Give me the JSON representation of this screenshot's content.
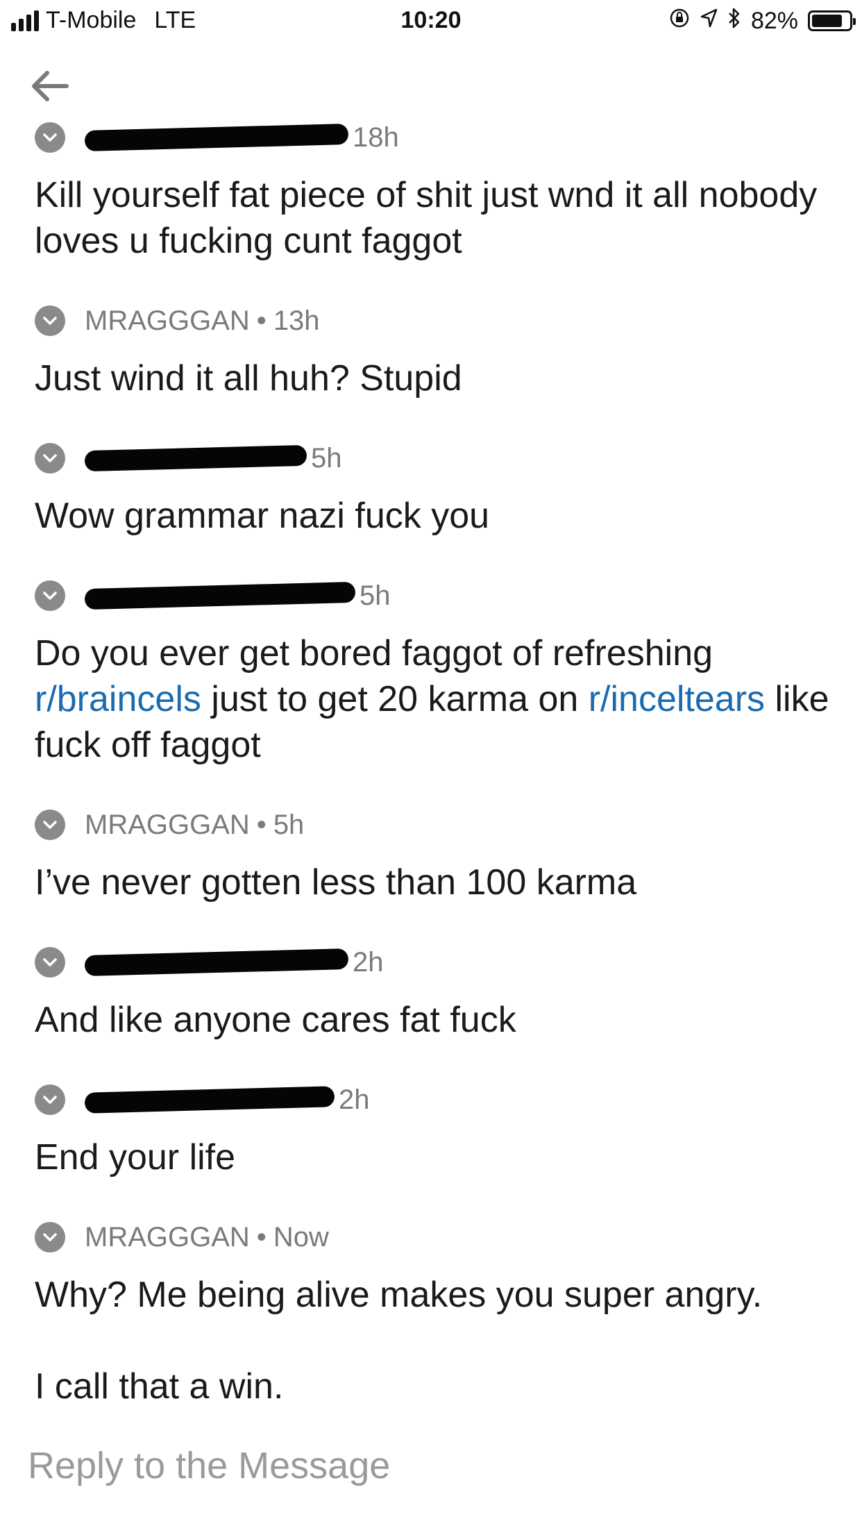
{
  "status_bar": {
    "carrier": "T-Mobile",
    "network": "LTE",
    "time": "10:20",
    "battery": "82%",
    "battery_level": 0.82
  },
  "messages": [
    {
      "author": "",
      "time": "18h",
      "redacted": true,
      "text": "Kill yourself fat piece of shit just wnd it all nobody loves u fucking cunt faggot"
    },
    {
      "author": "MRAGGGAN",
      "time": "13h",
      "redacted": false,
      "text": "Just wind it all huh? Stupid"
    },
    {
      "author": "",
      "time": "5h",
      "redacted": true,
      "text": "Wow grammar nazi fuck you"
    },
    {
      "author": "",
      "time": "5h",
      "redacted": true,
      "text_parts": [
        {
          "t": "Do you ever get bored faggot of refreshing "
        },
        {
          "t": "r/braincels",
          "link": true
        },
        {
          "t": " just to get 20 karma on "
        },
        {
          "t": "r/inceltears",
          "link": true
        },
        {
          "t": " like fuck off faggot"
        }
      ]
    },
    {
      "author": "MRAGGGAN",
      "time": "5h",
      "redacted": false,
      "text": "I’ve never gotten less than 100 karma"
    },
    {
      "author": "",
      "time": "2h",
      "redacted": true,
      "text": "And like anyone cares fat fuck"
    },
    {
      "author": "",
      "time": "2h",
      "redacted": true,
      "text": "End your life"
    },
    {
      "author": "MRAGGGAN",
      "time": "Now",
      "redacted": false,
      "paragraphs": [
        "Why? Me being alive makes you super angry.",
        "I call that a win."
      ]
    }
  ],
  "reply": {
    "placeholder": "Reply to the Message"
  },
  "icons": {
    "back": "arrow-left-icon",
    "collapse": "chevron-down-icon",
    "orientation_lock": "orientation-lock-icon",
    "location": "location-arrow-icon",
    "bluetooth": "bluetooth-icon"
  },
  "colors": {
    "link": "#1a6bb0",
    "meta": "#7a7a7a",
    "placeholder": "#9a9a9a"
  }
}
